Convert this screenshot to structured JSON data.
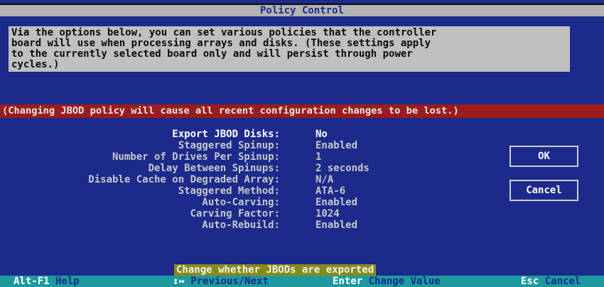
{
  "window": {
    "title": "Policy Control"
  },
  "description": {
    "lines": [
      "Via the options below, you can set various policies that the controller",
      "board will use when processing arrays and disks. (These settings apply",
      "to the currently selected board only and will persist through power",
      "cycles.)"
    ]
  },
  "warning": {
    "text": "(Changing JBOD policy will cause all recent configuration changes to be lost.)"
  },
  "settings": [
    {
      "label": "Export JBOD Disks:",
      "value": "No",
      "active": true
    },
    {
      "label": "Staggered Spinup:",
      "value": "Enabled",
      "active": false
    },
    {
      "label": "Number of Drives Per Spinup:",
      "value": "1",
      "active": false
    },
    {
      "label": "Delay Between Spinups:",
      "value": "2 seconds",
      "active": false
    },
    {
      "label": "Disable Cache on Degraded Array:",
      "value": "N/A",
      "active": false
    },
    {
      "label": "Staggered Method:",
      "value": "ATA-6",
      "active": false
    },
    {
      "label": "Auto-Carving:",
      "value": "Enabled",
      "active": false
    },
    {
      "label": "Carving Factor:",
      "value": "1024",
      "active": false
    },
    {
      "label": "Auto-Rebuild:",
      "value": "Enabled",
      "active": false
    }
  ],
  "buttons": {
    "ok_label": "OK",
    "cancel_label": "Cancel"
  },
  "hint": {
    "text": "Change whether JBODs are exported"
  },
  "footer": {
    "help_key": "Alt-F1",
    "help_label": "Help",
    "nav_key": "↕↔",
    "nav_label": "Previous/Next",
    "enter_key": "Enter",
    "enter_label": "Change Value",
    "esc_key": "Esc",
    "esc_label": "Cancel"
  },
  "colors": {
    "background": "#1c2a8c",
    "title_bar": "#b3b3b3",
    "warning_bar": "#9a1c1c",
    "hint_bar": "#8a8a1a",
    "footer_bar": "#1c9aa0"
  }
}
